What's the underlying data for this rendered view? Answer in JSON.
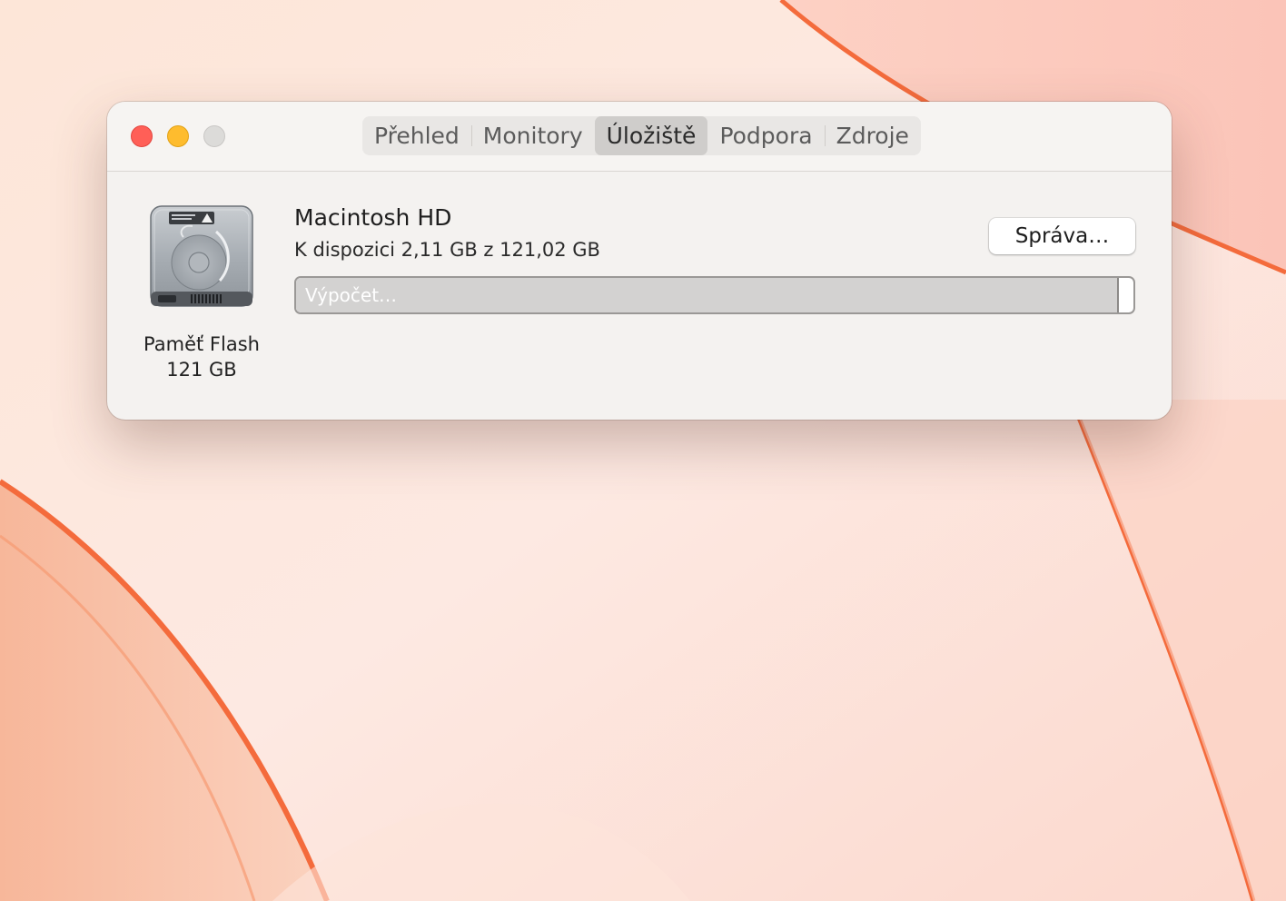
{
  "window": {
    "tabs": [
      {
        "label": "Přehled",
        "active": false
      },
      {
        "label": "Monitory",
        "active": false
      },
      {
        "label": "Úložiště",
        "active": true
      },
      {
        "label": "Podpora",
        "active": false
      },
      {
        "label": "Zdroje",
        "active": false
      }
    ]
  },
  "disk": {
    "type_label": "Paměť Flash",
    "size_label": "121 GB",
    "icon": "hard-drive-icon"
  },
  "volume": {
    "name": "Macintosh HD",
    "free_text": "K dispozici 2,11 GB z 121,02 GB",
    "manage_label": "Správa…",
    "bar_status": "Výpočet…",
    "used_fraction": 0.983
  },
  "colors": {
    "close": "#ff5f57",
    "minimize": "#febc2e",
    "zoom_disabled": "#dcdbd9",
    "wallpaper_accent": "#f26a3a"
  }
}
